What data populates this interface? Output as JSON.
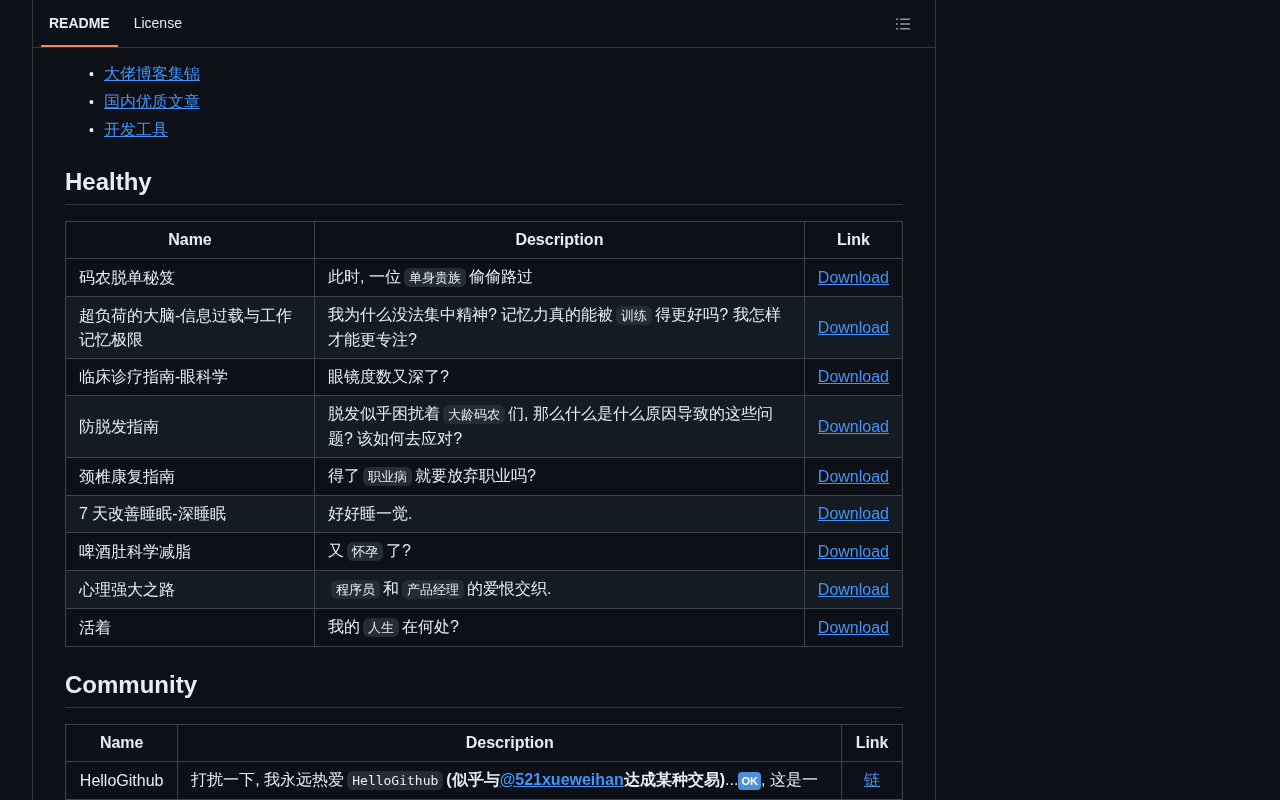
{
  "tabs": [
    {
      "label": "README",
      "selected": true
    },
    {
      "label": "License",
      "selected": false
    }
  ],
  "toc_links": [
    {
      "marker": "•",
      "text": "大佬博客集锦"
    },
    {
      "marker": "•",
      "text": "国内优质文章"
    },
    {
      "marker": "•",
      "text": "开发工具"
    }
  ],
  "sections": [
    {
      "heading": "Healthy",
      "columns": [
        "Name",
        "Description",
        "Link"
      ],
      "rows": [
        {
          "name": "码农脱单秘笈",
          "description": [
            {
              "kind": "text",
              "text": "此时, 一位"
            },
            {
              "kind": "code",
              "text": "单身贵族"
            },
            {
              "kind": "text",
              "text": "偷偷路过"
            }
          ],
          "link": "Download"
        },
        {
          "name": "超负荷的大脑-信息过载与工作记忆极限",
          "description": [
            {
              "kind": "text",
              "text": "我为什么没法集中精神? 记忆力真的能被"
            },
            {
              "kind": "code",
              "text": "训练"
            },
            {
              "kind": "text",
              "text": "得更好吗? 我怎样才能更专注?"
            }
          ],
          "link": "Download"
        },
        {
          "name": "临床诊疗指南-眼科学",
          "description": [
            {
              "kind": "text",
              "text": "眼镜度数又深了?"
            }
          ],
          "link": "Download"
        },
        {
          "name": "防脱发指南",
          "description": [
            {
              "kind": "text",
              "text": "脱发似乎困扰着"
            },
            {
              "kind": "code",
              "text": "大龄码农"
            },
            {
              "kind": "text",
              "text": "们, 那么什么是什么原因导致的这些问题? 该如何去应对?"
            }
          ],
          "link": "Download"
        },
        {
          "name": "颈椎康复指南",
          "description": [
            {
              "kind": "text",
              "text": "得了"
            },
            {
              "kind": "code",
              "text": "职业病"
            },
            {
              "kind": "text",
              "text": "就要放弃职业吗?"
            }
          ],
          "link": "Download"
        },
        {
          "name": "7 天改善睡眠-深睡眠",
          "description": [
            {
              "kind": "text",
              "text": "好好睡一觉."
            }
          ],
          "link": "Download"
        },
        {
          "name": "啤酒肚科学减脂",
          "description": [
            {
              "kind": "text",
              "text": "又"
            },
            {
              "kind": "code",
              "text": "怀孕"
            },
            {
              "kind": "text",
              "text": "了?"
            }
          ],
          "link": "Download"
        },
        {
          "name": "心理强大之路",
          "description": [
            {
              "kind": "code",
              "text": "程序员"
            },
            {
              "kind": "text",
              "text": "和"
            },
            {
              "kind": "code",
              "text": "产品经理"
            },
            {
              "kind": "text",
              "text": "的爱恨交织."
            }
          ],
          "link": "Download"
        },
        {
          "name": "活着",
          "description": [
            {
              "kind": "text",
              "text": "我的"
            },
            {
              "kind": "code",
              "text": "人生"
            },
            {
              "kind": "text",
              "text": "在何处?"
            }
          ],
          "link": "Download"
        }
      ]
    },
    {
      "heading": "Community",
      "columns": [
        "Name",
        "Description",
        "Link"
      ],
      "rows": [
        {
          "name": "HelloGithub",
          "description": [
            {
              "kind": "text",
              "text": "打扰一下, 我永远热爱"
            },
            {
              "kind": "code",
              "text": "HelloGithub"
            },
            {
              "kind": "bold",
              "text": "(似乎与"
            },
            {
              "kind": "link",
              "text": "@521xueweihan"
            },
            {
              "kind": "bold",
              "text": "达成某种交易)"
            },
            {
              "kind": "text",
              "text": "..."
            },
            {
              "kind": "badge",
              "text": "OK"
            },
            {
              "kind": "text",
              "text": ", 这是一"
            }
          ],
          "link": "链"
        }
      ]
    }
  ]
}
